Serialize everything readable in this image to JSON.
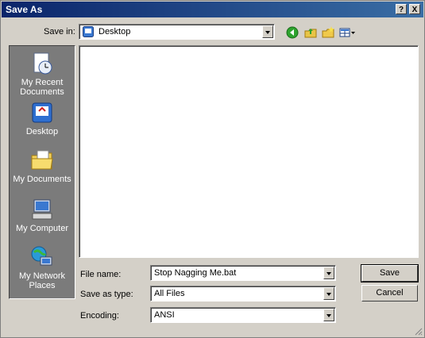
{
  "window": {
    "title": "Save As",
    "help_btn": "?",
    "close_btn": "X"
  },
  "toolbar": {
    "save_in_label": "Save in:",
    "save_in_value": "Desktop"
  },
  "places": [
    {
      "label1": "My Recent",
      "label2": "Documents"
    },
    {
      "label1": "Desktop",
      "label2": ""
    },
    {
      "label1": "My Documents",
      "label2": ""
    },
    {
      "label1": "My Computer",
      "label2": ""
    },
    {
      "label1": "My Network",
      "label2": "Places"
    }
  ],
  "form": {
    "file_name_label": "File name:",
    "file_name_value": "Stop Nagging Me.bat",
    "save_type_label": "Save as type:",
    "save_type_value": "All Files",
    "encoding_label": "Encoding:",
    "encoding_value": "ANSI"
  },
  "buttons": {
    "save": "Save",
    "cancel": "Cancel"
  },
  "colors": {
    "titlebar_start": "#0a246a",
    "titlebar_end": "#3a6ea5",
    "places_bg": "#7b7b7b",
    "face": "#d4d0c8"
  }
}
